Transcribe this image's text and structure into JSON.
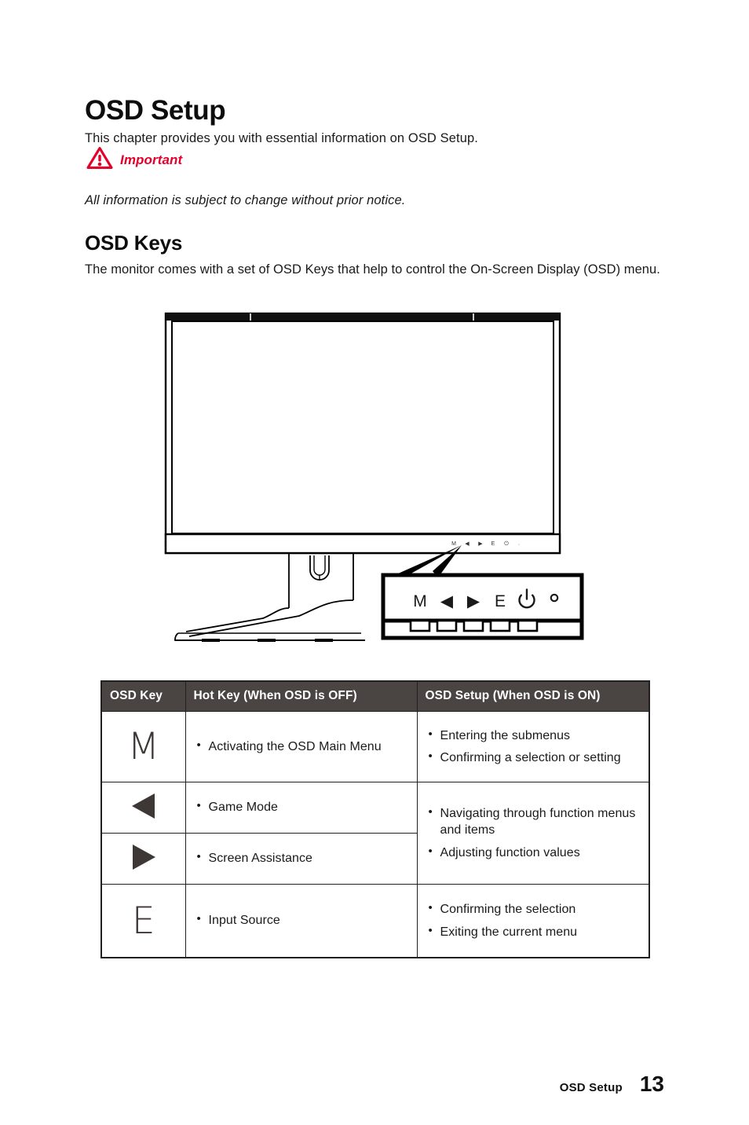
{
  "document": {
    "heading": "OSD Setup",
    "intro": "This chapter provides you with essential information on OSD Setup.",
    "important_label": "Important",
    "important_note": "All information is subject to change without prior notice.",
    "section_heading": "OSD Keys",
    "section_para": "The monitor comes with a set of OSD Keys that help to control the On-Screen Display (OSD) menu."
  },
  "figure": {
    "callout_keys": [
      "M",
      "◀",
      "▶",
      "E",
      "⏻",
      "○"
    ],
    "bezel_keys": [
      "M",
      "◀",
      "▶",
      "E",
      "⏻",
      "·"
    ]
  },
  "table": {
    "headers": {
      "key": "OSD Key",
      "hotkey": "Hot Key (When OSD is OFF)",
      "setup": "OSD Setup (When OSD is ON)"
    },
    "rows": {
      "m": {
        "key": "M",
        "hotkey": [
          "Activating the OSD Main Menu"
        ],
        "setup": [
          "Entering the submenus",
          "Confirming a selection or setting"
        ]
      },
      "left": {
        "key": "◀",
        "hotkey": [
          "Game Mode"
        ]
      },
      "right": {
        "key": "▶",
        "hotkey": [
          "Screen Assistance"
        ]
      },
      "arrows_setup": [
        "Navigating through function menus and items",
        "Adjusting function values"
      ],
      "e": {
        "key": "E",
        "hotkey": [
          "Input Source"
        ],
        "setup": [
          "Confirming the selection",
          "Exiting the current menu"
        ]
      }
    }
  },
  "footer": {
    "label": "OSD Setup",
    "page": "13"
  },
  "colors": {
    "accent_red": "#e4002b",
    "header_bg": "#4a4442",
    "ink": "#231f20",
    "glyph_gray": "#3d3736"
  }
}
